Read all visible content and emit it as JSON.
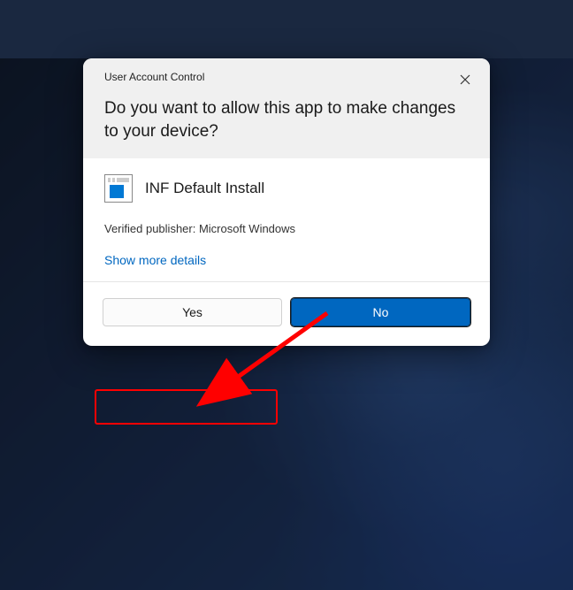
{
  "dialog": {
    "title_small": "User Account Control",
    "question": "Do you want to allow this app to make changes to your device?",
    "app_name": "INF Default Install",
    "publisher_line": "Verified publisher: Microsoft Windows",
    "more_details": "Show more details",
    "yes_label": "Yes",
    "no_label": "No"
  }
}
